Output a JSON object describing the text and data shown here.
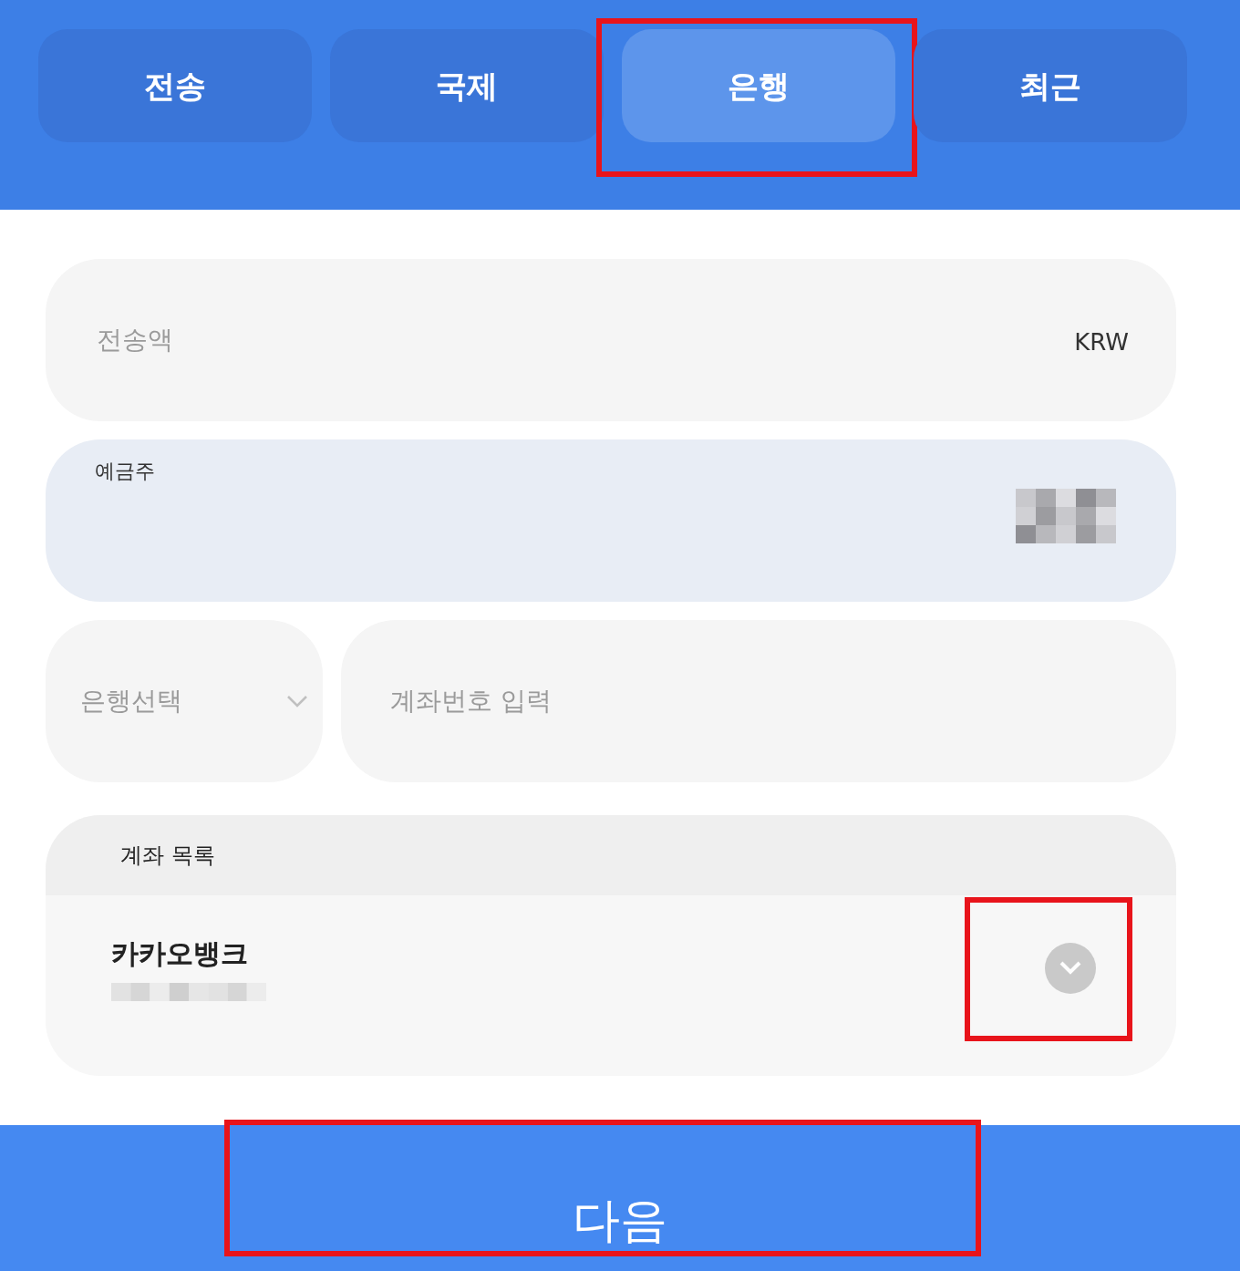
{
  "tabs": [
    {
      "label": "전송",
      "selected": false,
      "highlighted": false
    },
    {
      "label": "국제",
      "selected": false,
      "highlighted": false
    },
    {
      "label": "은행",
      "selected": true,
      "highlighted": true
    },
    {
      "label": "최근",
      "selected": false,
      "highlighted": false
    }
  ],
  "amount": {
    "placeholder": "전송액",
    "currency": "KRW"
  },
  "holder": {
    "label": "예금주",
    "masked": true
  },
  "bank_select": {
    "placeholder": "은행선택"
  },
  "account_number": {
    "placeholder": "계좌번호 입력"
  },
  "account_list": {
    "title": "계좌 목록",
    "items": [
      {
        "bank": "카카오뱅크",
        "masked": true,
        "highlighted": true
      }
    ]
  },
  "next_button": {
    "label": "다음",
    "highlighted": true
  }
}
